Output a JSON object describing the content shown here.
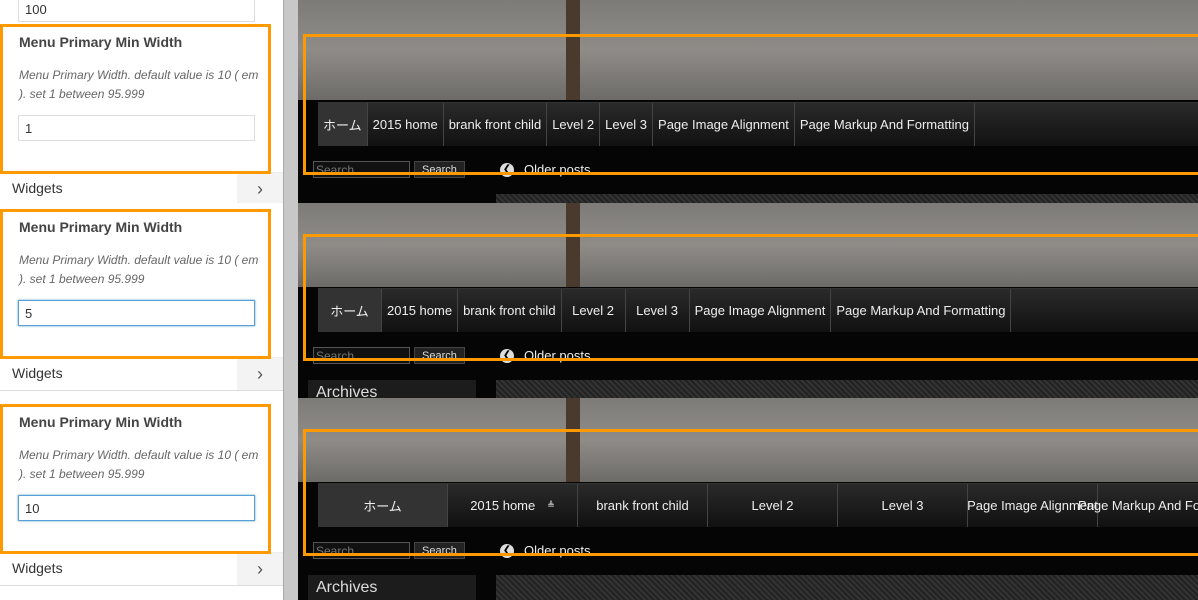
{
  "top_field_value": "100",
  "accent": "#ff9900",
  "setting": {
    "title": "Menu Primary Min Width",
    "description": "Menu Primary Width. default value is 10 ( em ). set 1 between 95.999"
  },
  "widgets_label": "Widgets",
  "values": [
    "1",
    "5",
    "10"
  ],
  "nav": [
    "ホーム",
    "2015 home",
    "brank front child",
    "Level 2",
    "Level 3",
    "Page Image Alignment",
    "Page Markup And Formatting"
  ],
  "search_placeholder": "Search",
  "search_button": "Search",
  "older_posts": "Older posts",
  "archives": "Archives"
}
